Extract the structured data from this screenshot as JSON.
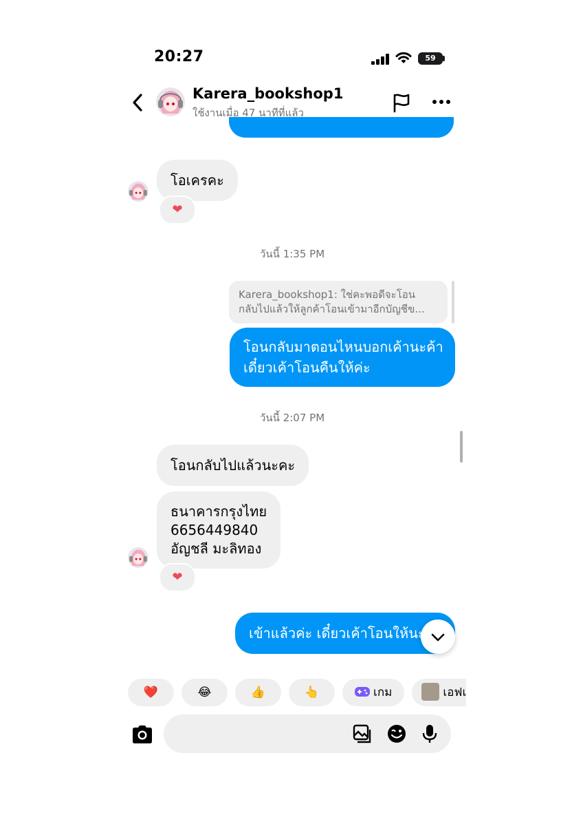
{
  "status_bar": {
    "time": "20:27",
    "battery": "59"
  },
  "header": {
    "name": "Karera_bookshop1",
    "status": "ใช้งานเมื่อ 47 นาทีที่แล้ว"
  },
  "messages": {
    "m1": "โอเครคะ",
    "m1_reaction": "❤",
    "ts1": "วันนี้ 1:35 PM",
    "reply_preview_line1": "Karera_bookshop1: ใช่คะพอดีจะโอน",
    "reply_preview_line2": "กลับไปแล้วให้ลูกค้าโอนเข้ามาอีกบัญชีข...",
    "m2_line1": "โอนกลับมาตอนไหนบอกเค้านะค้า",
    "m2_line2": "เดี๋ยวเค้าโอนคืนให้ค่ะ",
    "ts2": "วันนี้ 2:07 PM",
    "m3": "โอนกลับไปแล้วนะคะ",
    "m4_line1": "ธนาคารกรุงไทย",
    "m4_line2": "6656449840",
    "m4_line3": "อัญชลี มะลิทอง",
    "m4_reaction": "❤",
    "m5": "เข้าแล้วค่ะ เดี๋ยวเค้าโอนให้นะคะ"
  },
  "quick_reactions": [
    {
      "emoji": "❤️"
    },
    {
      "emoji": "😂"
    },
    {
      "emoji": "👍"
    },
    {
      "emoji": "👆"
    },
    {
      "label": "เกม"
    },
    {
      "label": "เอฟเฟกต์"
    }
  ],
  "colors": {
    "accent": "#0095f6",
    "bubble_in": "#efefef",
    "heart": "#ed4956"
  },
  "icons": [
    "back-chevron-icon",
    "flag-icon",
    "more-icon",
    "camera-icon",
    "gallery-icon",
    "sticker-icon",
    "microphone-icon",
    "chevron-down-icon",
    "game-icon"
  ]
}
